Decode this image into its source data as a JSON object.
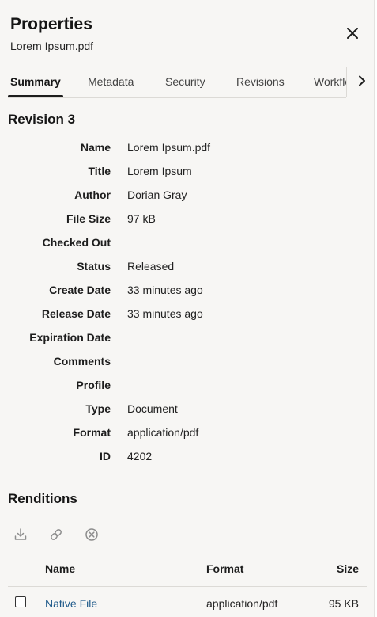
{
  "header": {
    "title": "Properties",
    "subtitle": "Lorem Ipsum.pdf",
    "close_icon": "close-icon"
  },
  "tabs": [
    {
      "label": "Summary",
      "active": true
    },
    {
      "label": "Metadata",
      "active": false
    },
    {
      "label": "Security",
      "active": false
    },
    {
      "label": "Revisions",
      "active": false
    },
    {
      "label": "Workflow",
      "active": false
    }
  ],
  "revision": {
    "title": "Revision 3",
    "properties": [
      {
        "label": "Name",
        "value": "Lorem Ipsum.pdf"
      },
      {
        "label": "Title",
        "value": "Lorem Ipsum"
      },
      {
        "label": "Author",
        "value": "Dorian Gray"
      },
      {
        "label": "File Size",
        "value": "97 kB"
      },
      {
        "label": "Checked Out",
        "value": ""
      },
      {
        "label": "Status",
        "value": "Released"
      },
      {
        "label": "Create Date",
        "value": "33 minutes ago"
      },
      {
        "label": "Release Date",
        "value": "33 minutes ago"
      },
      {
        "label": "Expiration Date",
        "value": ""
      },
      {
        "label": "Comments",
        "value": ""
      },
      {
        "label": "Profile",
        "value": ""
      },
      {
        "label": "Type",
        "value": "Document"
      },
      {
        "label": "Format",
        "value": "application/pdf"
      },
      {
        "label": "ID",
        "value": "4202"
      }
    ]
  },
  "renditions": {
    "title": "Renditions",
    "toolbar": [
      "download-icon",
      "link-icon",
      "remove-icon"
    ],
    "columns": {
      "name": "Name",
      "format": "Format",
      "size": "Size"
    },
    "rows": [
      {
        "name": "Native File",
        "format": "application/pdf",
        "size": "95 KB"
      }
    ]
  },
  "colors": {
    "panel_bg": "#f7f6f4",
    "link": "#1f5a8a",
    "divider": "#dcdad6"
  }
}
